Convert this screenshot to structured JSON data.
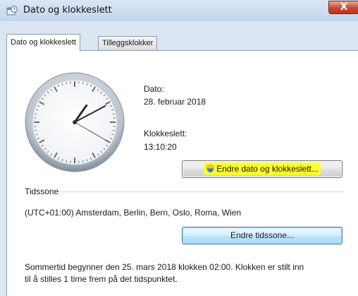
{
  "window": {
    "title": "Dato og klokkeslett",
    "close_label": "X"
  },
  "tabs": [
    {
      "label": "Dato og klokkeslett",
      "active": true
    },
    {
      "label": "Tilleggsklokker",
      "active": false
    }
  ],
  "date": {
    "label": "Dato:",
    "value": "28. februar 2018"
  },
  "time": {
    "label": "Klokkeslett:",
    "value": "13:10:20"
  },
  "clock": {
    "hours": 13,
    "minutes": 10,
    "seconds": 20
  },
  "buttons": {
    "change_datetime": "Endre dato og klokkeslett...",
    "change_timezone": "Endre tidssone..."
  },
  "timezone": {
    "group_label": "Tidssone",
    "value": "(UTC+01:00) Amsterdam, Berlin, Bern, Oslo, Roma, Wien"
  },
  "dst_notice": {
    "line1": "Sommertid begynner den 25. mars 2018 klokken 02:00. Klokken er stilt inn",
    "line2": "til å stilles 1 time frem på det tidspunktet."
  },
  "colors": {
    "highlight": "#fbff2b",
    "close_button": "#c7482f"
  }
}
